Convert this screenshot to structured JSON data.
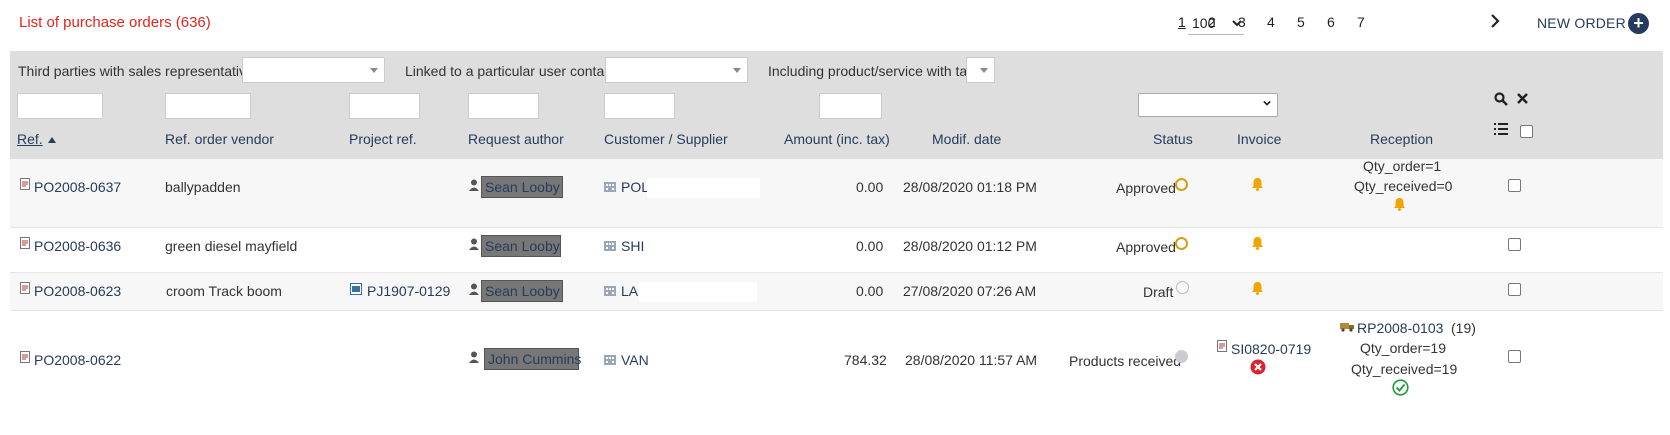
{
  "header": {
    "title": "List of purchase orders (636)",
    "page_size": "100",
    "pages": [
      "1",
      "2",
      "3",
      "4",
      "5",
      "6",
      "7"
    ],
    "current_page": "1",
    "new_order_label": "NEW ORDER"
  },
  "filters": {
    "sales_rep_label": "Third parties with sales representative:",
    "user_contact_label": "Linked to a particular user contact:",
    "product_tag_label": "Including product/service with tag:"
  },
  "columns": {
    "ref": "Ref.",
    "ref_vendor": "Ref. order vendor",
    "project_ref": "Project ref.",
    "request_author": "Request author",
    "customer_supplier": "Customer / Supplier",
    "amount": "Amount (inc. tax)",
    "modif_date": "Modif. date",
    "status": "Status",
    "invoice": "Invoice",
    "reception": "Reception"
  },
  "rows": [
    {
      "ref": "PO2008-0637",
      "ref_vendor": "ballypadden",
      "project": "",
      "author": "Sean Looby",
      "supplier": "POL",
      "amount": "0.00",
      "date": "28/08/2020 01:18 PM",
      "status": "Approved",
      "reception_line1": "Qty_order=1",
      "reception_line2": "Qty_received=0"
    },
    {
      "ref": "PO2008-0636",
      "ref_vendor": "green diesel mayfield",
      "project": "",
      "author": "Sean Looby",
      "supplier": "SHI",
      "amount": "0.00",
      "date": "28/08/2020 01:12 PM",
      "status": "Approved"
    },
    {
      "ref": "PO2008-0623",
      "ref_vendor": "croom Track boom",
      "project": "PJ1907-0129",
      "author": "Sean Looby",
      "supplier": "LA",
      "amount": "0.00",
      "date": "27/08/2020 07:26 AM",
      "status": "Draft"
    },
    {
      "ref": "PO2008-0622",
      "ref_vendor": "",
      "project": "",
      "author": "John Cummins",
      "supplier": "VAN",
      "amount": "784.32",
      "date": "28/08/2020 11:57 AM",
      "status": "Products received",
      "invoice": "SI0820-0719",
      "reception_ref": "RP2008-0103",
      "reception_count": "(19)",
      "reception_line1": "Qty_order=19",
      "reception_line2": "Qty_received=19"
    }
  ],
  "colors": {
    "title_red": "#e0251b",
    "link_blue": "#263c5c",
    "approved_ring": "#d4a017",
    "bell": "#f0a500",
    "ok_green": "#1a9b3c",
    "error_red": "#d9232e"
  }
}
